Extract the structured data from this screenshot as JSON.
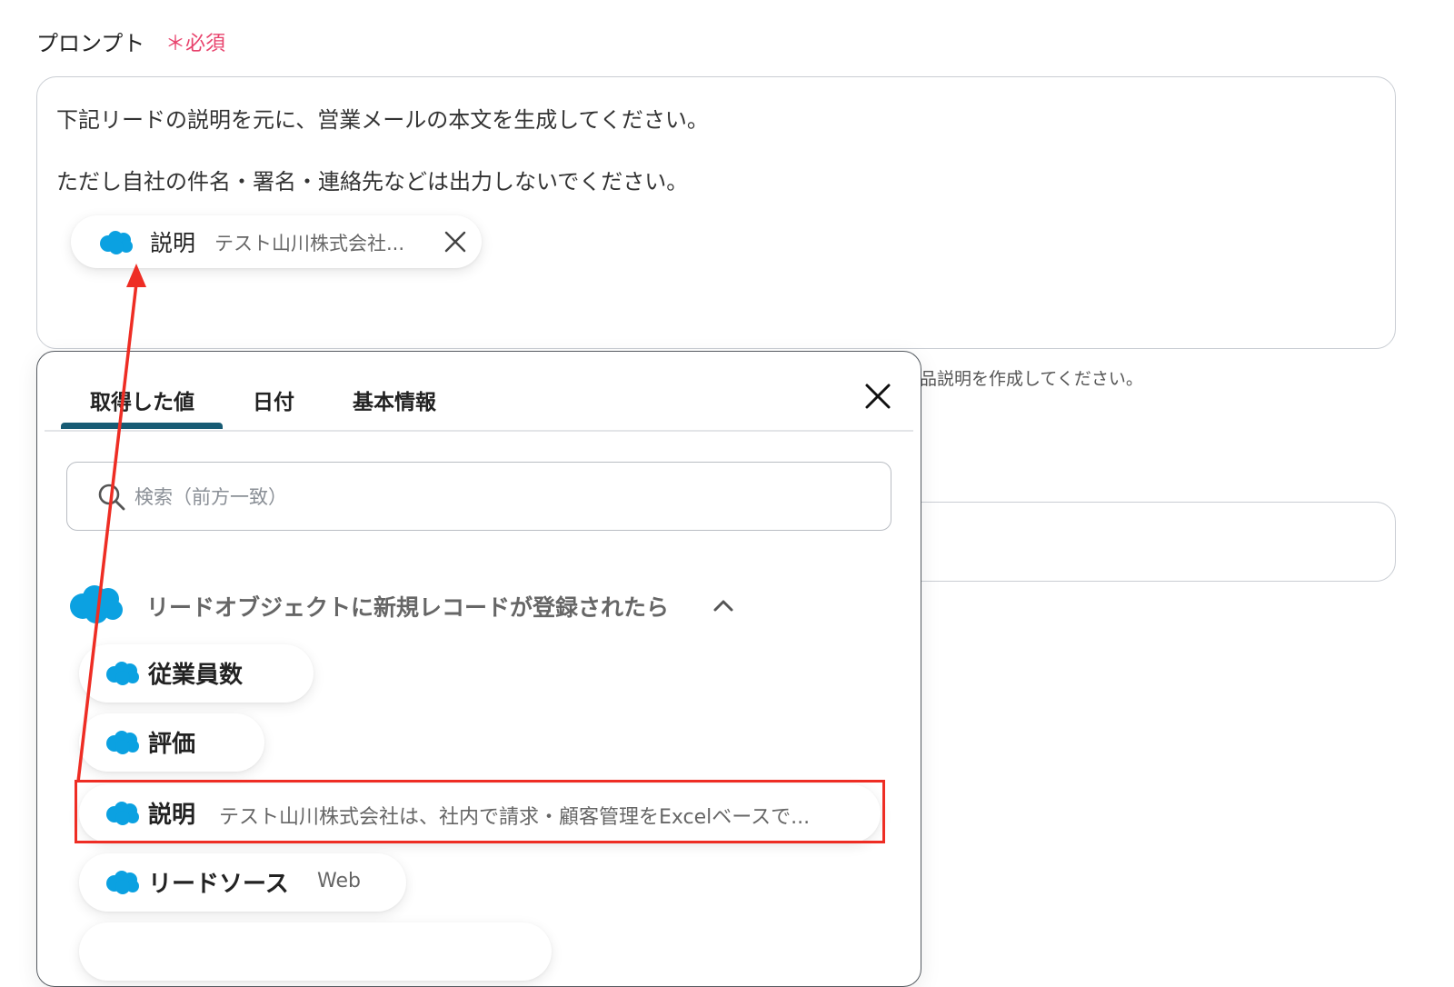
{
  "field": {
    "label": "プロンプト",
    "required_mark": "＊必須",
    "prompt_lines": [
      "下記リードの説明を元に、営業メールの本文を生成してください。",
      "ただし自社の件名・署名・連絡先などは出力しないでください。"
    ],
    "chip": {
      "label": "説明",
      "value": "テスト山川株式会社...",
      "icon": "salesforce-cloud-icon",
      "remove_icon": "close-icon"
    },
    "hint_partial": "品説明を作成してください。"
  },
  "popup": {
    "tabs": [
      {
        "label": "取得した値",
        "active": true
      },
      {
        "label": "日付",
        "active": false
      },
      {
        "label": "基本情報",
        "active": false
      }
    ],
    "close_icon": "close-icon",
    "search": {
      "placeholder": "検索（前方一致）",
      "value": "",
      "icon": "search-icon"
    },
    "group": {
      "title": "リードオブジェクトに新規レコードが登録されたら",
      "icon": "salesforce-cloud-icon",
      "expanded": true,
      "items": [
        {
          "label": "従業員数",
          "value": ""
        },
        {
          "label": "評価",
          "value": ""
        },
        {
          "label": "説明",
          "value": "テスト山川株式会社は、社内で請求・顧客管理をExcelベースで...",
          "highlighted": true
        },
        {
          "label": "リードソース",
          "value": "Web"
        }
      ]
    }
  },
  "colors": {
    "required": "#e8426c",
    "tab_active_underline": "#175b74",
    "salesforce_blue": "#0ba1e1",
    "annotation_red": "#ee2d24"
  }
}
